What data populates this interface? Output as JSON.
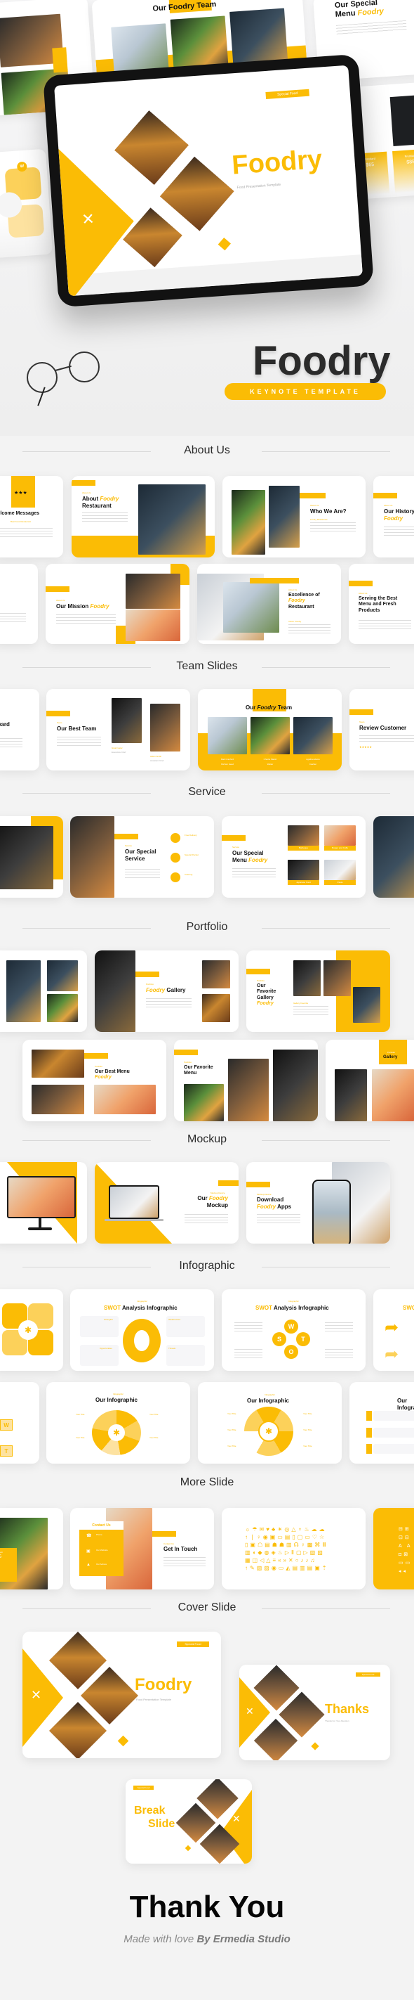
{
  "hero": {
    "tablet_badge": "Special Food",
    "tablet_title": "Foodry",
    "tablet_subtitle": "Food Presentation Template",
    "bg_team_title": "Our Foodry Team",
    "bg_menu_title_1": "Our Special",
    "bg_menu_title_2": "Menu",
    "bg_menu_accent": "Foodry",
    "bg_pricing": [
      {
        "label": "Standard",
        "price": "$65"
      },
      {
        "label": "Premium",
        "price": "$85"
      }
    ],
    "product_title": "Foodry",
    "product_badge": "KEYNOTE TEMPLATE"
  },
  "colors": {
    "accent": "#fbbc05",
    "background": "#f3f3f3",
    "text": "#111111"
  },
  "sections": {
    "about": "About Us",
    "team": "Team Slides",
    "service": "Service",
    "portfolio": "Portfolio",
    "mockup": "Mockup",
    "infographic": "Infographic",
    "more": "More Slide",
    "cover": "Cover Slide"
  },
  "about": {
    "row1": [
      {
        "kicker": "",
        "title": "Welcome Messages",
        "sub": "Best Food Restaurant"
      },
      {
        "kicker": "About Us",
        "title": "About",
        "accent": "Foodry",
        "title2": "Restaurant"
      },
      {
        "kicker": "About Us",
        "title": "Who We Are?",
        "sub": "Luxury Restaurant"
      },
      {
        "kicker": "About Us",
        "title": "Our History",
        "accent": "Foodry"
      }
    ],
    "row2": [
      {
        "title": "Our Mission",
        "accent": "Foodry",
        "kicker": "About Us"
      },
      {
        "kicker": "About Us",
        "title": "Excellence of",
        "accent": "Foodry",
        "title2": "Restaurant",
        "sub": "Vision Foodry"
      },
      {
        "kicker": "About Us",
        "title": "Serving the Best Menu and Fresh Products"
      }
    ]
  },
  "team": {
    "reward_title": "Reward",
    "best_team": {
      "kicker": "Team",
      "title": "Our Best Team",
      "members": [
        {
          "name": "Gina Foster",
          "role": "Executive Chef"
        },
        {
          "name": "Aiden Smith",
          "role": "Assistant Chef"
        }
      ]
    },
    "foodry_team": {
      "kicker": "Team",
      "title": "Our",
      "accent": "Foodry",
      "title2": "Team",
      "members": [
        {
          "name": "Matt Cranford",
          "role": "Kitchen Head"
        },
        {
          "name": "Charlie Marsh",
          "role": "Waiter"
        },
        {
          "name": "Agatha Adams",
          "role": "Cashier"
        }
      ]
    },
    "review": {
      "kicker": "Team",
      "title": "Review Customer",
      "stars": "★★★★★"
    }
  },
  "service": {
    "special_service": {
      "kicker": "Service",
      "title": "Our Special Service",
      "items": [
        "Free Delivery",
        "Special Packet",
        "Catering"
      ]
    },
    "special_menu": {
      "kicker": "Service",
      "title": "Our Special",
      "title2": "Menu",
      "accent": "Foodry",
      "items": [
        "Barbeque",
        "Burger and Coffe",
        "Japanese Food",
        "Pasta"
      ]
    }
  },
  "portfolio": {
    "gallery": {
      "kicker": "Portfolio",
      "accent": "Foodry",
      "title": "Gallery"
    },
    "favorite_gallery": {
      "kicker": "Portfolio",
      "title": "Our Favorite Gallery",
      "accent": "Foodry",
      "sub": "Gallery Favorite"
    },
    "best_menu": {
      "kicker": "Portfolio",
      "title": "Our Best Menu",
      "accent": "Foodry"
    },
    "favorite_menu": {
      "kicker": "Portfolio",
      "title": "Our Favorite Menu"
    },
    "gallery2": {
      "kicker": "Portfolio",
      "title": "Gallery"
    }
  },
  "mockup": {
    "laptop": {
      "kicker": "Mockup Device",
      "title": "Our",
      "accent": "Foodry",
      "title2": "Mockup"
    },
    "phone": {
      "kicker": "Mockup Device",
      "title": "Download",
      "accent": "Foodry",
      "title2": "Apps"
    }
  },
  "infographic": {
    "swot": {
      "kicker": "Infographic",
      "accent": "SWOT",
      "title": "Analysis Infographic",
      "labels": [
        "Strengths",
        "Weaknesses",
        "Opportunities",
        "Threats"
      ],
      "letters": [
        "S",
        "W",
        "O",
        "T"
      ]
    },
    "our": {
      "kicker": "Infographic",
      "title": "Our Infographic",
      "item_title": "Your Title"
    }
  },
  "more": {
    "pricing": {
      "label": "Premium",
      "price": "$85"
    },
    "contact": {
      "box_title": "Contact Us",
      "items": [
        "Phone",
        "Our Website",
        "Our Adress"
      ],
      "kicker": "Contact Us",
      "title": "Get In Touch"
    }
  },
  "cover": {
    "main": {
      "badge": "Special Food",
      "title": "Foodry",
      "subtitle": "Food Presentation Template"
    },
    "thanks": {
      "badge": "Special Food",
      "title": "Thanks",
      "subtitle": "Thanks For Your Attention"
    },
    "break": {
      "badge": "Special Food",
      "title": "Break",
      "title2": "Slide"
    }
  },
  "footer": {
    "title": "Thank You",
    "credit_light": "Made with love",
    "credit_bold": "By Ermedia Studio"
  }
}
